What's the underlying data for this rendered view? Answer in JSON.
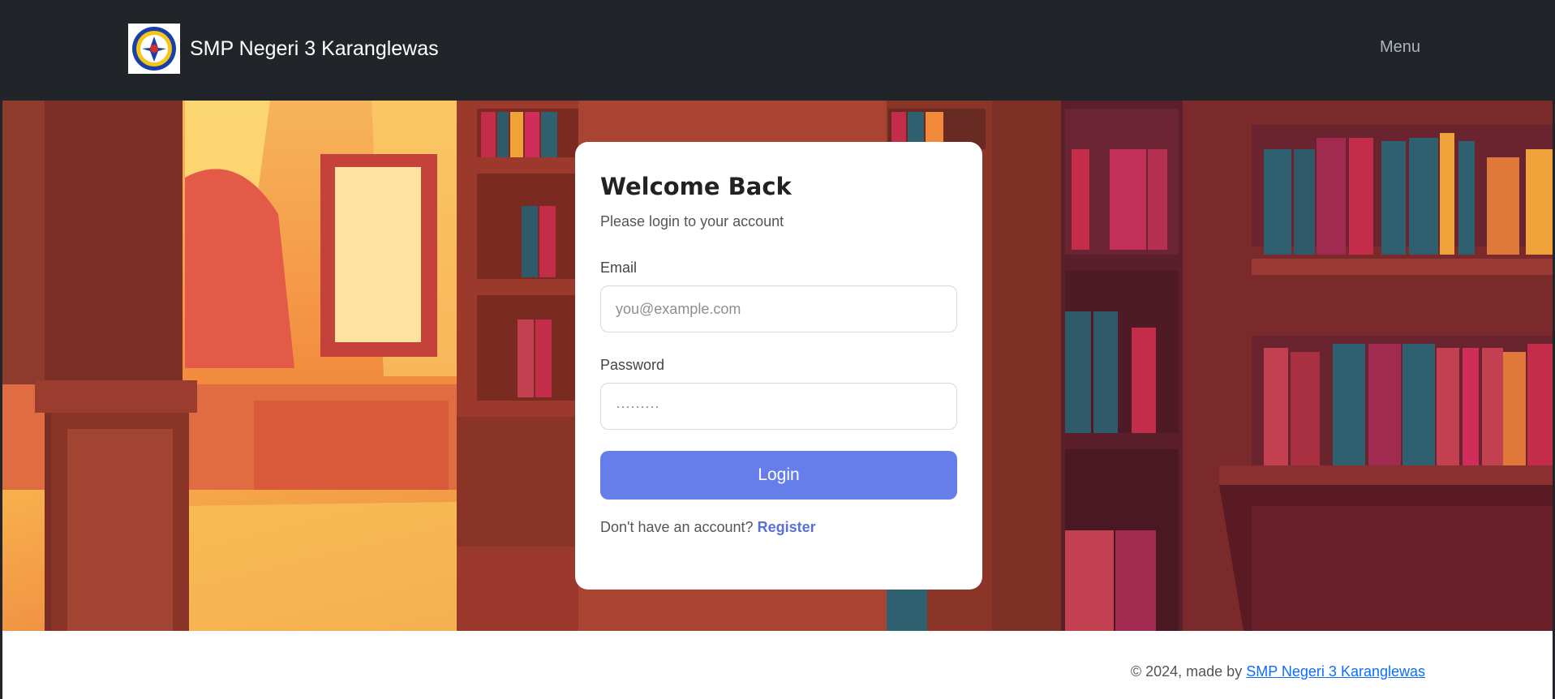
{
  "navbar": {
    "brand_name": "SMP Negeri 3 Karanglewas",
    "menu_label": "Menu",
    "logo_icon": "school-emblem-icon"
  },
  "login": {
    "title": "Welcome Back",
    "subtitle": "Please login to your account",
    "email_label": "Email",
    "email_placeholder": "you@example.com",
    "password_label": "Password",
    "password_placeholder": "·········",
    "login_label": "Login",
    "register_prompt": "Don't have an account?",
    "register_label": "Register"
  },
  "footer": {
    "copyright_prefix": "© 2024, made by",
    "link_text": "SMP Negeri 3 Karanglewas"
  },
  "colors": {
    "navbar_bg": "#212529",
    "button": "#667eea",
    "link": "#5a6fd8",
    "footer_link": "#0d6efd"
  }
}
